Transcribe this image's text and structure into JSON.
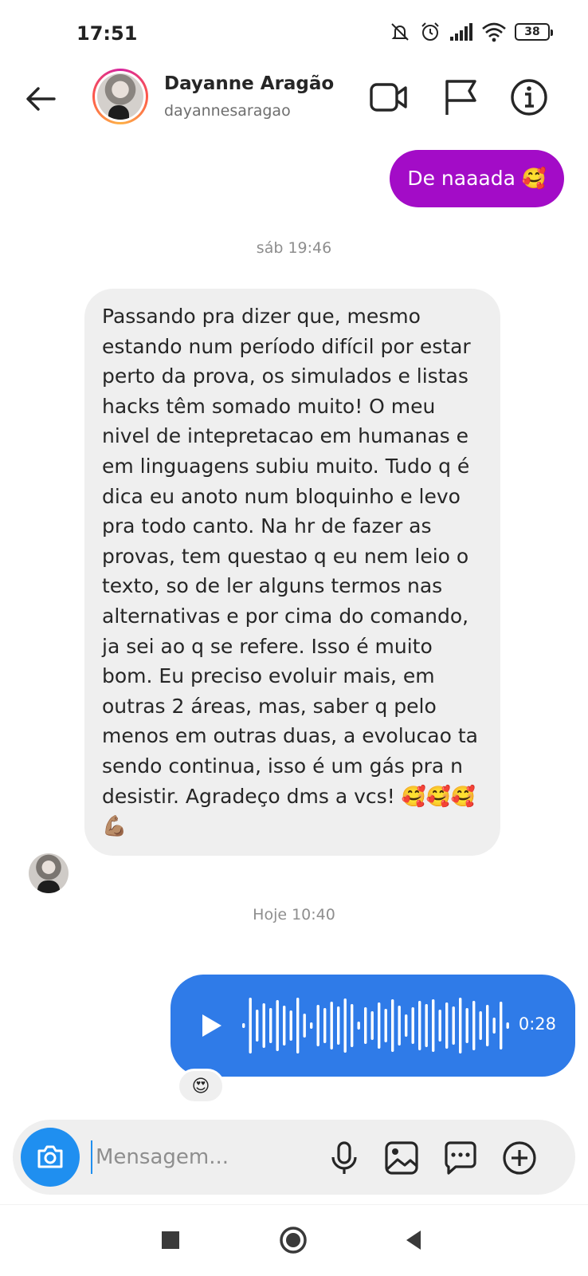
{
  "status_bar": {
    "time": "17:51",
    "battery": "38",
    "icons": [
      "mute-icon",
      "alarm-icon",
      "signal-icon",
      "wifi-icon",
      "battery-icon"
    ]
  },
  "header": {
    "name": "Dayanne Aragão",
    "username": "dayannesaragao",
    "icons": [
      "back-arrow-icon",
      "video-camera-icon",
      "flag-icon",
      "info-icon"
    ]
  },
  "messages": {
    "sent_text": "De naaada 🥰",
    "timestamp_1": "sáb 19:46",
    "received_text": "Passando pra dizer que, mesmo estando num período difícil por estar perto da prova, os simulados e listas hacks têm somado muito! O meu nivel de intepretacao em humanas e em linguagens subiu muito. Tudo q é dica eu anoto num bloquinho e levo pra todo canto. Na hr de fazer as provas, tem questao q eu nem leio o texto, so de ler alguns termos nas alternativas e por cima do comando, ja sei ao q se refere. Isso é muito bom. Eu preciso evoluir mais, em outras 2 áreas, mas, saber q pelo menos em outras duas, a evolucao ta sendo continua, isso é um gás pra n desistir. Agradeço dms a vcs! 🥰🥰🥰💪🏽",
    "timestamp_2": "Hoje 10:40",
    "voice_duration": "0:28",
    "voice_reaction": "😍"
  },
  "composer": {
    "placeholder": "Mensagem...",
    "icons": [
      "camera-icon",
      "microphone-icon",
      "gallery-icon",
      "sticker-chat-icon",
      "add-icon"
    ]
  },
  "colors": {
    "sent_purple": "#a30cc7",
    "voice_blue": "#2f7be8",
    "camera_blue": "#1f8ff0",
    "received_bg": "#efefef"
  }
}
